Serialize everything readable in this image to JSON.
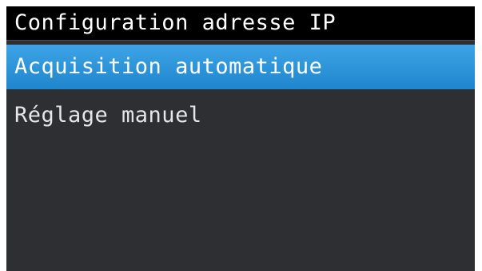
{
  "screen": {
    "title": "Configuration adresse IP",
    "colors": {
      "background": "#2d2f33",
      "title_background": "#000000",
      "selection": "#2a94d8",
      "text": "#ffffff"
    }
  },
  "menu": {
    "items": [
      {
        "label": "Acquisition automatique",
        "selected": true
      },
      {
        "label": "Réglage manuel",
        "selected": false
      }
    ]
  }
}
